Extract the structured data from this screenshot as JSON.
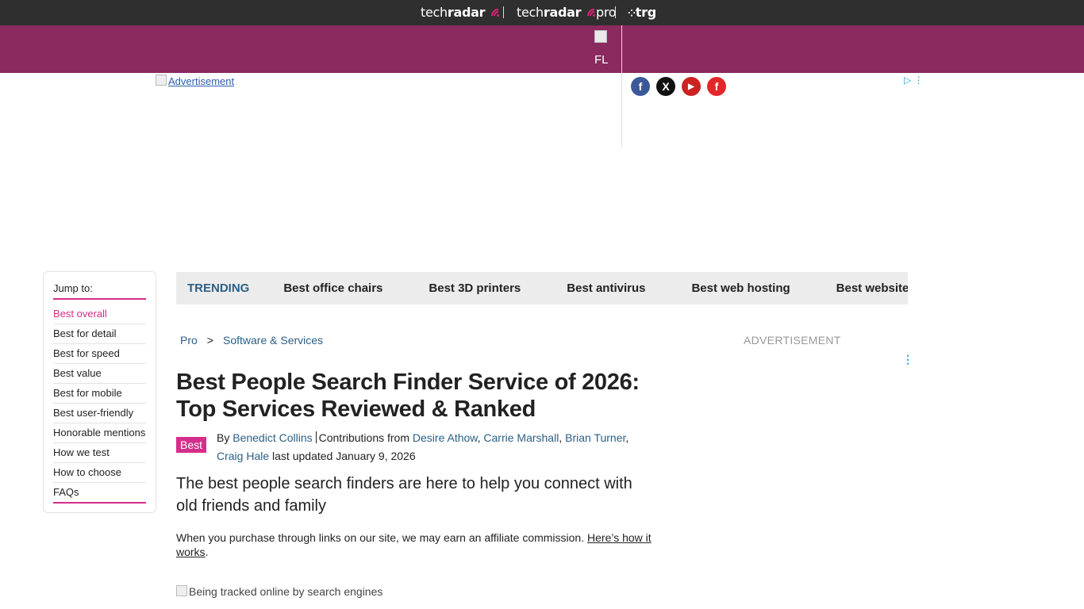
{
  "topbar": {
    "brand1": {
      "prefix": "tech",
      "bold": "radar"
    },
    "brand2": {
      "prefix": "tech",
      "bold": "radar",
      "suffix": "pro"
    },
    "brand3": "trg"
  },
  "banner": {
    "alt_text": "FL"
  },
  "ad": {
    "label": "Advertisement"
  },
  "social": {
    "facebook": "f",
    "x": "X",
    "youtube": "▶",
    "flipboard": "f"
  },
  "jump_nav": {
    "title": "Jump to:",
    "items": [
      "Best overall",
      "Best for detail",
      "Best for speed",
      "Best value",
      "Best for mobile",
      "Best user-friendly",
      "Honorable mentions",
      "How we test",
      "How to choose",
      "FAQs"
    ]
  },
  "trending": {
    "label": "TRENDING",
    "items": [
      "Best office chairs",
      "Best 3D printers",
      "Best antivirus",
      "Best web hosting",
      "Best website builder"
    ]
  },
  "breadcrumb": {
    "items": [
      "Pro",
      "Software & Services"
    ],
    "separator": ">"
  },
  "sidebar_ad": {
    "label": "ADVERTISEMENT"
  },
  "article": {
    "title": "Best People Search Finder Service of 2026: Top Services Reviewed & Ranked",
    "badge": "Best",
    "by_label": "By",
    "author": "Benedict Collins",
    "contrib_label": "Contributions from",
    "contributors": [
      "Desire Athow",
      "Carrie Marshall",
      "Brian Turner",
      "Craig Hale"
    ],
    "updated_label": "last updated",
    "updated_date": "January 9, 2026",
    "subheading": "The best people search finders are here to help you connect with old friends and family",
    "affiliate_text": "When you purchase through links on our site, we may earn an affiliate commission.",
    "affiliate_link": "Here’s how it works",
    "affiliate_end": ".",
    "image_alt": "Being tracked online by search engines"
  },
  "colors": {
    "accent": "#d52f8a",
    "brand_purple": "#8a2a5e",
    "link": "#2b5f86"
  }
}
